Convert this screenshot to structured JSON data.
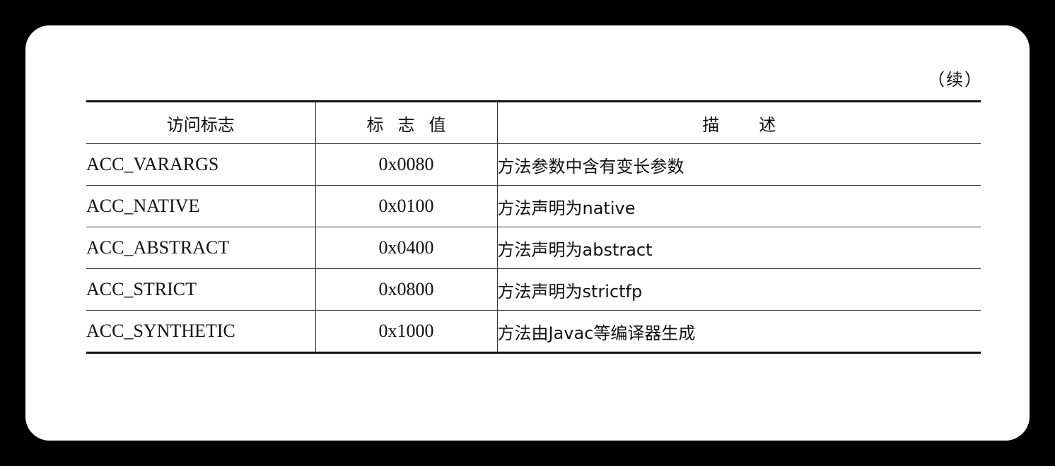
{
  "continued_label": "（续）",
  "table": {
    "headers": [
      "访问标志",
      "标志值",
      "描述"
    ],
    "rows": [
      {
        "name": "ACC_VARARGS",
        "value": "0x0080",
        "desc": "方法参数中含有变长参数"
      },
      {
        "name": "ACC_NATIVE",
        "value": "0x0100",
        "desc": "方法声明为native"
      },
      {
        "name": "ACC_ABSTRACT",
        "value": "0x0400",
        "desc": "方法声明为abstract"
      },
      {
        "name": "ACC_STRICT",
        "value": "0x0800",
        "desc": "方法声明为strictfp"
      },
      {
        "name": "ACC_SYNTHETIC",
        "value": "0x1000",
        "desc": "方法由Javac等编译器生成"
      }
    ]
  }
}
